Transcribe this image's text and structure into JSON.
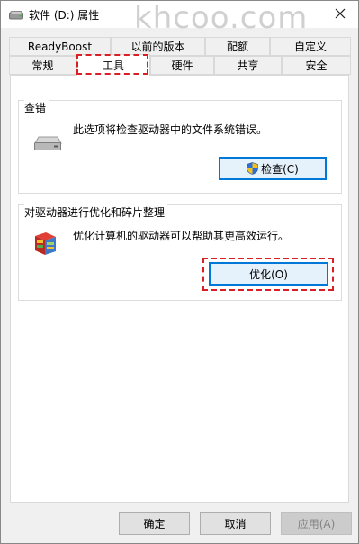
{
  "window": {
    "title": "软件 (D:) 属性",
    "watermark": "khcoo.com"
  },
  "tabs": {
    "row1": [
      "ReadyBoost",
      "以前的版本",
      "配额",
      "自定义"
    ],
    "row2": [
      "常规",
      "工具",
      "硬件",
      "共享",
      "安全"
    ],
    "active": "工具"
  },
  "error_check": {
    "title": "查错",
    "description": "此选项将检查驱动器中的文件系统错误。",
    "button_label": "检查(C)",
    "icon": "drive-icon"
  },
  "optimize": {
    "title": "对驱动器进行优化和碎片整理",
    "description": "优化计算机的驱动器可以帮助其更高效运行。",
    "button_label": "优化(O)",
    "icon": "defrag-icon"
  },
  "footer": {
    "ok_label": "确定",
    "cancel_label": "取消",
    "apply_label": "应用(A)"
  },
  "colors": {
    "highlight_dash": "#d81f26",
    "focus_blue": "#0078d7"
  }
}
